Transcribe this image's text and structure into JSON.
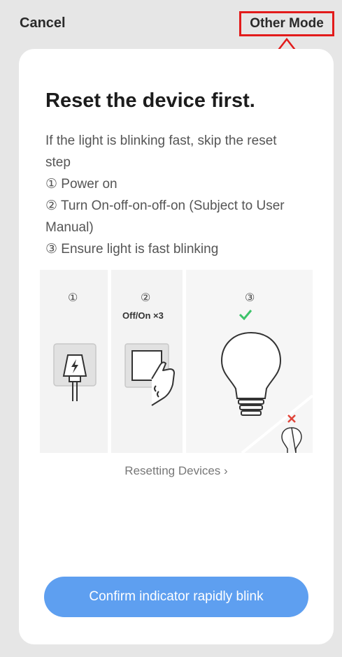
{
  "topbar": {
    "cancel_label": "Cancel",
    "other_mode_label": "Other Mode"
  },
  "card": {
    "title": "Reset the device first.",
    "description": [
      "If the light is blinking fast, skip the reset step",
      "① Power on",
      "② Turn On-off-on-off-on (Subject to User Manual)",
      "③ Ensure light is fast blinking"
    ],
    "illustration": {
      "steps": [
        "①",
        "②",
        "③"
      ],
      "switch_caption": "Off/On ×3"
    },
    "reset_link_label": "Resetting Devices  ›",
    "confirm_label": "Confirm indicator rapidly blink"
  },
  "colors": {
    "background": "#e6e6e6",
    "card": "#ffffff",
    "button": "#5e9ff0",
    "annotation": "#e21b1b",
    "check": "#3cc36a",
    "cross": "#e0453a"
  }
}
